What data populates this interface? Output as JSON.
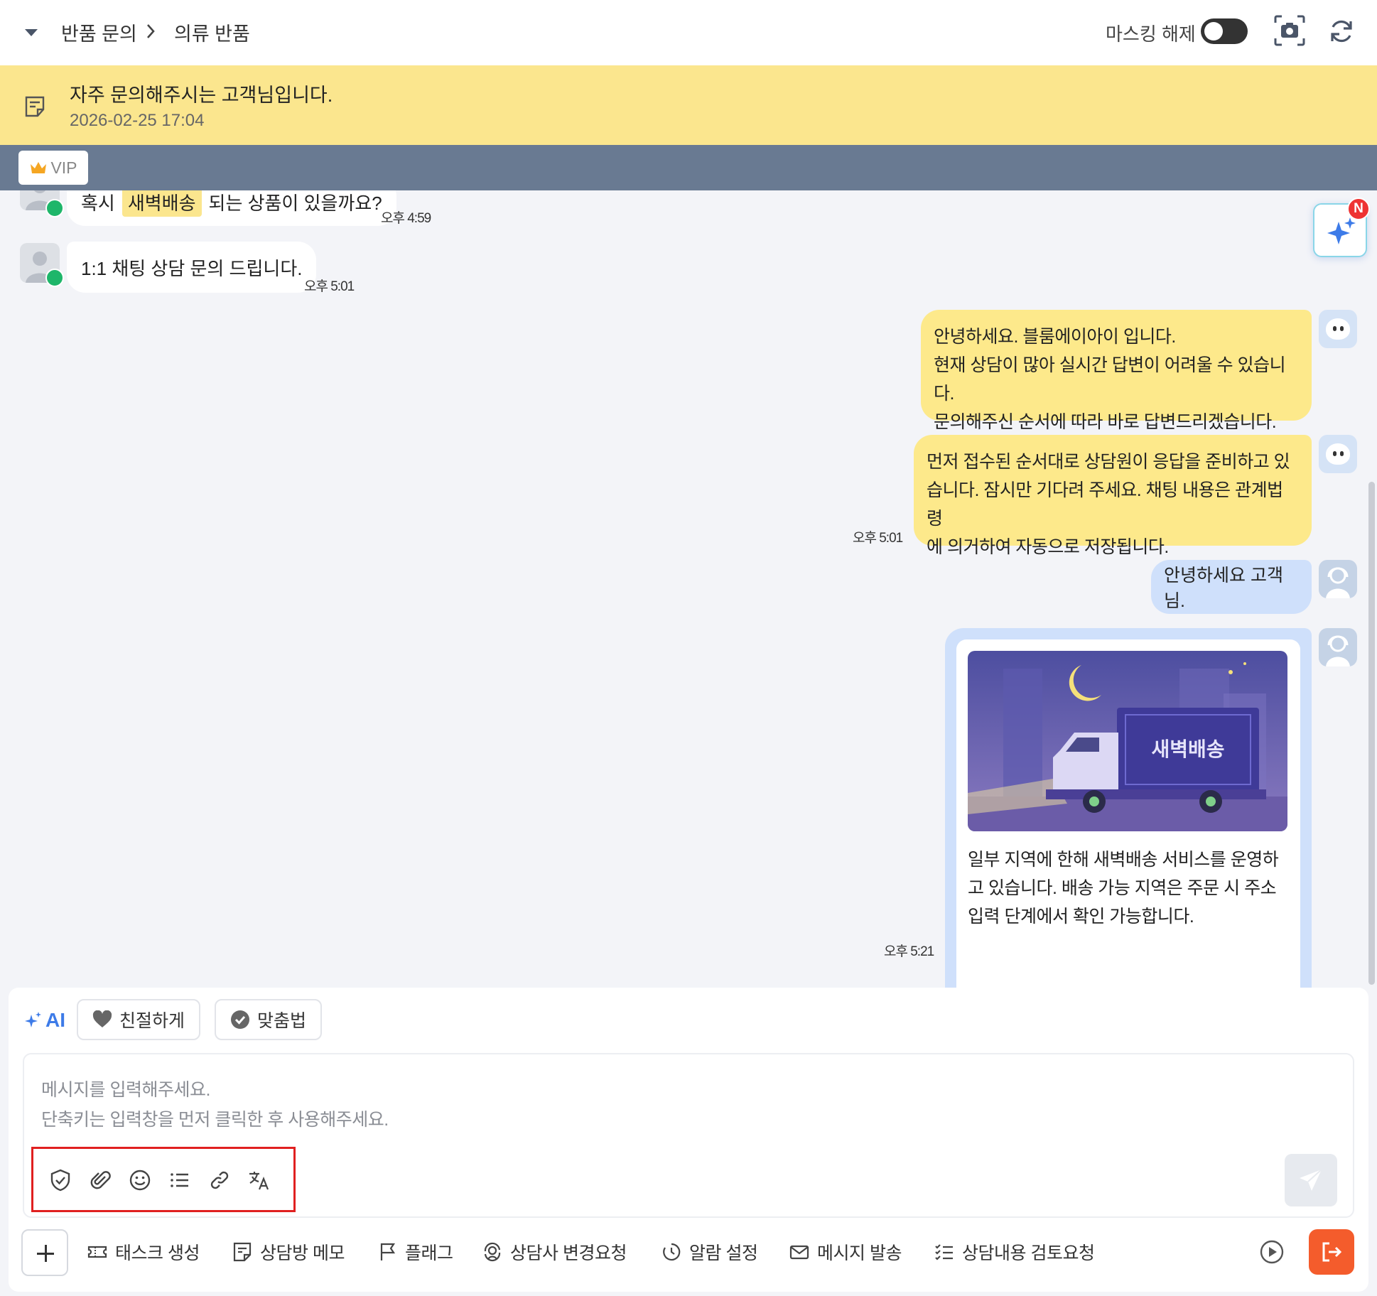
{
  "header": {
    "crumb_1": "반품 문의",
    "crumb_2": "의류 반품",
    "masking_label": "마스킹 해제"
  },
  "notice": {
    "title": "자주 문의해주시는 고객님입니다.",
    "time": "2026-02-25 17:04"
  },
  "tag": {
    "vip": "VIP"
  },
  "messages": {
    "m1": {
      "before": "혹시",
      "highlight": "새벽배송",
      "after": "되는 상품이 있을까요?",
      "time": "오후 4:59"
    },
    "m2": {
      "text": "1:1 채팅 상담 문의 드립니다.",
      "time": "오후 5:01"
    },
    "m3": {
      "lines": [
        "안녕하세요. 블룸에이아이 입니다.",
        "현재 상담이 많아 실시간 답변이 어려울 수 있습니다.",
        "문의해주신 순서에 따라 바로 답변드리겠습니다."
      ]
    },
    "m4": {
      "lines": [
        "먼저 접수된 순서대로 상담원이 응답을 준비하고 있",
        "습니다. 잠시만 기다려 주세요. 채팅 내용은 관계법령",
        "에 의거하여 자동으로 저장됩니다."
      ],
      "time": "오후 5:01"
    },
    "m5": {
      "text": "안녕하세요 고객님."
    },
    "m6": {
      "image_text": "새벽배송",
      "lines": [
        "일부 지역에 한해 새벽배송 서비스를 운영하",
        "고 있습니다. 배송 가능 지역은 주문 시 주소",
        "입력 단계에서 확인 가능합니다."
      ],
      "time": "오후 5:21"
    }
  },
  "ai_badge": "N",
  "composer": {
    "ai_label": "AI",
    "chip_friendly": "친절하게",
    "chip_spelling": "맞춤법",
    "placeholder_1": "메시지를 입력해주세요.",
    "placeholder_2": "단축키는 입력창을 먼저 클릭한 후 사용해주세요.",
    "tools": [
      "shield-icon",
      "paperclip-icon",
      "smile-icon",
      "list-icon",
      "link-icon",
      "translate-icon"
    ]
  },
  "actions": {
    "task": "태스크 생성",
    "memo": "상담방 메모",
    "flag": "플래그",
    "agent_change": "상담사 변경요청",
    "alarm": "알람 설정",
    "send_message": "메시지 발송",
    "review": "상담내용 검토요청"
  },
  "colors": {
    "notice_bg": "#fbe68e",
    "tagbar_bg": "#697a92",
    "bot_bubble": "#fde98b",
    "agent_bubble": "#cfe0fb",
    "accent": "#3d7be8",
    "exit": "#f45c2c",
    "highlight_box": "#e02020"
  }
}
